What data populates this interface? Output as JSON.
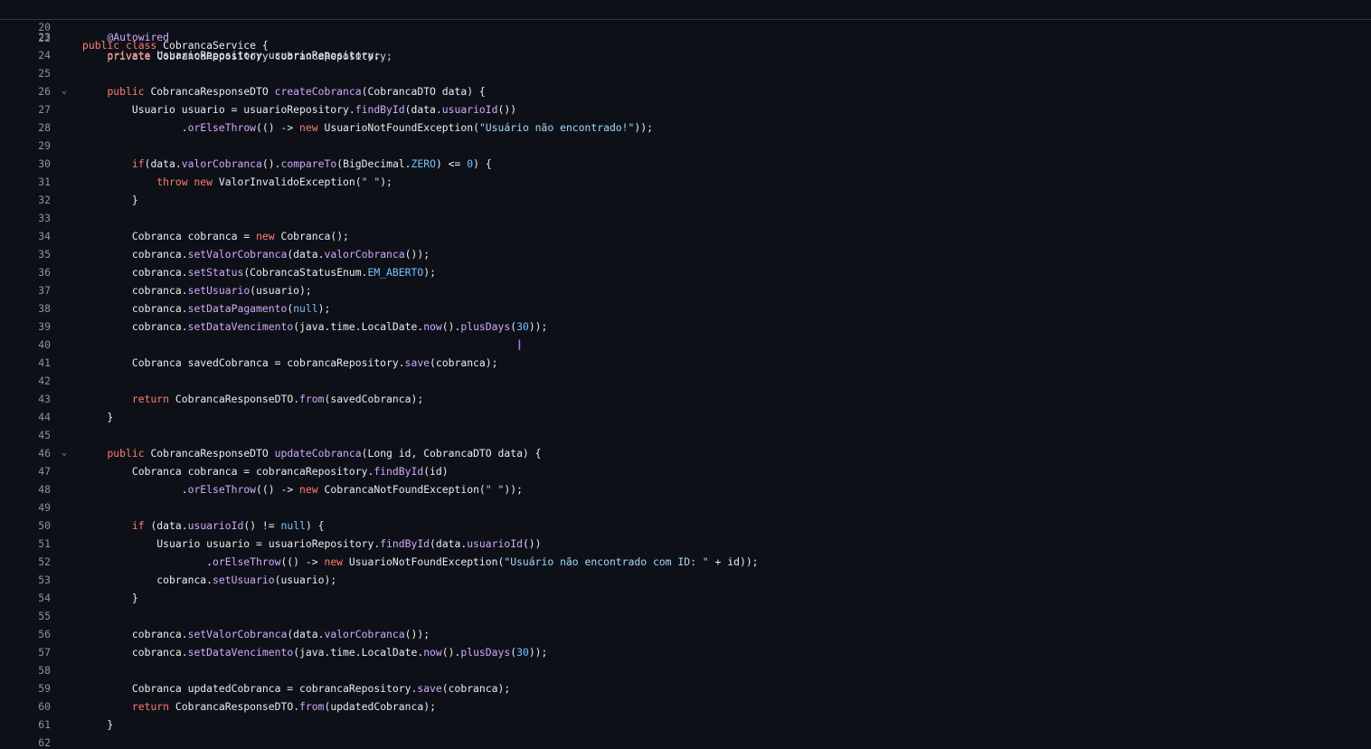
{
  "sticky": {
    "number": "20",
    "tokens": [
      {
        "t": "public class ",
        "c": "k"
      },
      {
        "t": "CobrancaService {",
        "c": "p"
      }
    ]
  },
  "partial_line": {
    "number": "22",
    "text": "    private CobrancaRepository cobrancaRepository;"
  },
  "lines": [
    {
      "number": "23",
      "tokens": [
        {
          "t": "    "
        },
        {
          "t": "@Autowired",
          "c": "a"
        }
      ]
    },
    {
      "number": "24",
      "tokens": [
        {
          "t": "    "
        },
        {
          "t": "private ",
          "c": "k"
        },
        {
          "t": "UsuarioRepository usuarioRepository;"
        }
      ]
    },
    {
      "number": "25",
      "tokens": []
    },
    {
      "number": "26",
      "fold": "⌄",
      "tokens": [
        {
          "t": "    "
        },
        {
          "t": "public ",
          "c": "k"
        },
        {
          "t": "CobrancaResponseDTO "
        },
        {
          "t": "createCobranca",
          "c": "f"
        },
        {
          "t": "(CobrancaDTO data) {"
        }
      ]
    },
    {
      "number": "27",
      "tokens": [
        {
          "t": "        Usuario usuario = usuarioRepository."
        },
        {
          "t": "findById",
          "c": "f"
        },
        {
          "t": "(data."
        },
        {
          "t": "usuarioId",
          "c": "f"
        },
        {
          "t": "())"
        }
      ]
    },
    {
      "number": "28",
      "tokens": [
        {
          "t": "                ."
        },
        {
          "t": "orElseThrow",
          "c": "f"
        },
        {
          "t": "(() -> "
        },
        {
          "t": "new ",
          "c": "k"
        },
        {
          "t": "UsuarioNotFoundException("
        },
        {
          "t": "\"Usuário não encontrado!\"",
          "c": "s"
        },
        {
          "t": "));"
        }
      ]
    },
    {
      "number": "29",
      "tokens": []
    },
    {
      "number": "30",
      "tokens": [
        {
          "t": "        "
        },
        {
          "t": "if",
          "c": "k"
        },
        {
          "t": "(data."
        },
        {
          "t": "valorCobranca",
          "c": "f"
        },
        {
          "t": "()."
        },
        {
          "t": "compareTo",
          "c": "f"
        },
        {
          "t": "(BigDecimal."
        },
        {
          "t": "ZERO",
          "c": "c"
        },
        {
          "t": ") <= "
        },
        {
          "t": "0",
          "c": "c"
        },
        {
          "t": ") {"
        }
      ]
    },
    {
      "number": "31",
      "tokens": [
        {
          "t": "            "
        },
        {
          "t": "throw ",
          "c": "k"
        },
        {
          "t": "new ",
          "c": "k"
        },
        {
          "t": "ValorInvalidoException("
        },
        {
          "t": "\" \"",
          "c": "s"
        },
        {
          "t": ");"
        }
      ]
    },
    {
      "number": "32",
      "tokens": [
        {
          "t": "        }"
        }
      ]
    },
    {
      "number": "33",
      "tokens": []
    },
    {
      "number": "34",
      "tokens": [
        {
          "t": "        Cobranca cobranca = "
        },
        {
          "t": "new ",
          "c": "k"
        },
        {
          "t": "Cobranca();"
        }
      ]
    },
    {
      "number": "35",
      "tokens": [
        {
          "t": "        cobranca."
        },
        {
          "t": "setValorCobranca",
          "c": "f"
        },
        {
          "t": "(data."
        },
        {
          "t": "valorCobranca",
          "c": "f"
        },
        {
          "t": "());"
        }
      ]
    },
    {
      "number": "36",
      "tokens": [
        {
          "t": "        cobranca."
        },
        {
          "t": "setStatus",
          "c": "f"
        },
        {
          "t": "(CobrancaStatusEnum."
        },
        {
          "t": "EM_ABERTO",
          "c": "c"
        },
        {
          "t": ");"
        }
      ]
    },
    {
      "number": "37",
      "tokens": [
        {
          "t": "        cobranca."
        },
        {
          "t": "setUsuario",
          "c": "f"
        },
        {
          "t": "(usuario);"
        }
      ]
    },
    {
      "number": "38",
      "tokens": [
        {
          "t": "        cobranca."
        },
        {
          "t": "setDataPagamento",
          "c": "f"
        },
        {
          "t": "("
        },
        {
          "t": "null",
          "c": "c"
        },
        {
          "t": ");"
        }
      ]
    },
    {
      "number": "39",
      "tokens": [
        {
          "t": "        cobranca."
        },
        {
          "t": "setDataVencimento",
          "c": "f"
        },
        {
          "t": "(java.time.LocalDate."
        },
        {
          "t": "now",
          "c": "f"
        },
        {
          "t": "()."
        },
        {
          "t": "plusDays",
          "c": "f"
        },
        {
          "t": "("
        },
        {
          "t": "30",
          "c": "c"
        },
        {
          "t": "));"
        }
      ]
    },
    {
      "number": "40",
      "tokens": []
    },
    {
      "number": "41",
      "tokens": [
        {
          "t": "        Cobranca savedCobranca = cobrancaRepository."
        },
        {
          "t": "save",
          "c": "f"
        },
        {
          "t": "(cobranca);"
        }
      ]
    },
    {
      "number": "42",
      "tokens": []
    },
    {
      "number": "43",
      "tokens": [
        {
          "t": "        "
        },
        {
          "t": "return ",
          "c": "k"
        },
        {
          "t": "CobrancaResponseDTO."
        },
        {
          "t": "from",
          "c": "f"
        },
        {
          "t": "(savedCobranca);"
        }
      ]
    },
    {
      "number": "44",
      "tokens": [
        {
          "t": "    }"
        }
      ]
    },
    {
      "number": "45",
      "tokens": []
    },
    {
      "number": "46",
      "fold": "⌄",
      "tokens": [
        {
          "t": "    "
        },
        {
          "t": "public ",
          "c": "k"
        },
        {
          "t": "CobrancaResponseDTO "
        },
        {
          "t": "updateCobranca",
          "c": "f"
        },
        {
          "t": "(Long id, CobrancaDTO data) {"
        }
      ]
    },
    {
      "number": "47",
      "tokens": [
        {
          "t": "        Cobranca cobranca = cobrancaRepository."
        },
        {
          "t": "findById",
          "c": "f"
        },
        {
          "t": "(id)"
        }
      ]
    },
    {
      "number": "48",
      "tokens": [
        {
          "t": "                ."
        },
        {
          "t": "orElseThrow",
          "c": "f"
        },
        {
          "t": "(() -> "
        },
        {
          "t": "new ",
          "c": "k"
        },
        {
          "t": "CobrancaNotFoundException("
        },
        {
          "t": "\" \"",
          "c": "s"
        },
        {
          "t": "));"
        }
      ]
    },
    {
      "number": "49",
      "tokens": []
    },
    {
      "number": "50",
      "tokens": [
        {
          "t": "        "
        },
        {
          "t": "if ",
          "c": "k"
        },
        {
          "t": "(data."
        },
        {
          "t": "usuarioId",
          "c": "f"
        },
        {
          "t": "() != "
        },
        {
          "t": "null",
          "c": "c"
        },
        {
          "t": ") {"
        }
      ]
    },
    {
      "number": "51",
      "tokens": [
        {
          "t": "            Usuario usuario = usuarioRepository."
        },
        {
          "t": "findById",
          "c": "f"
        },
        {
          "t": "(data."
        },
        {
          "t": "usuarioId",
          "c": "f"
        },
        {
          "t": "())"
        }
      ]
    },
    {
      "number": "52",
      "tokens": [
        {
          "t": "                    ."
        },
        {
          "t": "orElseThrow",
          "c": "f"
        },
        {
          "t": "(() -> "
        },
        {
          "t": "new ",
          "c": "k"
        },
        {
          "t": "UsuarioNotFoundException("
        },
        {
          "t": "\"Usuário não encontrado com ID: \"",
          "c": "s"
        },
        {
          "t": " + id));"
        }
      ]
    },
    {
      "number": "53",
      "tokens": [
        {
          "t": "            cobranca."
        },
        {
          "t": "setUsuario",
          "c": "f"
        },
        {
          "t": "(usuario);"
        }
      ]
    },
    {
      "number": "54",
      "tokens": [
        {
          "t": "        }"
        }
      ]
    },
    {
      "number": "55",
      "tokens": []
    },
    {
      "number": "56",
      "tokens": [
        {
          "t": "        cobranca."
        },
        {
          "t": "setValorCobranca",
          "c": "f"
        },
        {
          "t": "(data."
        },
        {
          "t": "valorCobranca",
          "c": "f"
        },
        {
          "t": "());"
        }
      ]
    },
    {
      "number": "57",
      "tokens": [
        {
          "t": "        cobranca."
        },
        {
          "t": "setDataVencimento",
          "c": "f"
        },
        {
          "t": "(java.time.LocalDate."
        },
        {
          "t": "now",
          "c": "f"
        },
        {
          "t": "()."
        },
        {
          "t": "plusDays",
          "c": "f"
        },
        {
          "t": "("
        },
        {
          "t": "30",
          "c": "c"
        },
        {
          "t": "));"
        }
      ]
    },
    {
      "number": "58",
      "tokens": []
    },
    {
      "number": "59",
      "tokens": [
        {
          "t": "        Cobranca updatedCobranca = cobrancaRepository."
        },
        {
          "t": "save",
          "c": "f"
        },
        {
          "t": "(cobranca);"
        }
      ]
    },
    {
      "number": "60",
      "tokens": [
        {
          "t": "        "
        },
        {
          "t": "return ",
          "c": "k"
        },
        {
          "t": "CobrancaResponseDTO."
        },
        {
          "t": "from",
          "c": "f"
        },
        {
          "t": "(updatedCobranca);"
        }
      ]
    },
    {
      "number": "61",
      "tokens": [
        {
          "t": "    }"
        }
      ]
    },
    {
      "number": "62",
      "tokens": []
    }
  ],
  "cursor_icon": "text-cursor-icon",
  "cursor_glyph": "I",
  "colors": {
    "background": "#0d1117",
    "line_number": "#8b949e",
    "keyword": "#ff7b72",
    "function": "#d2a8ff",
    "constant": "#79c0ff",
    "string": "#a5d6ff",
    "text": "#e6edf3"
  }
}
